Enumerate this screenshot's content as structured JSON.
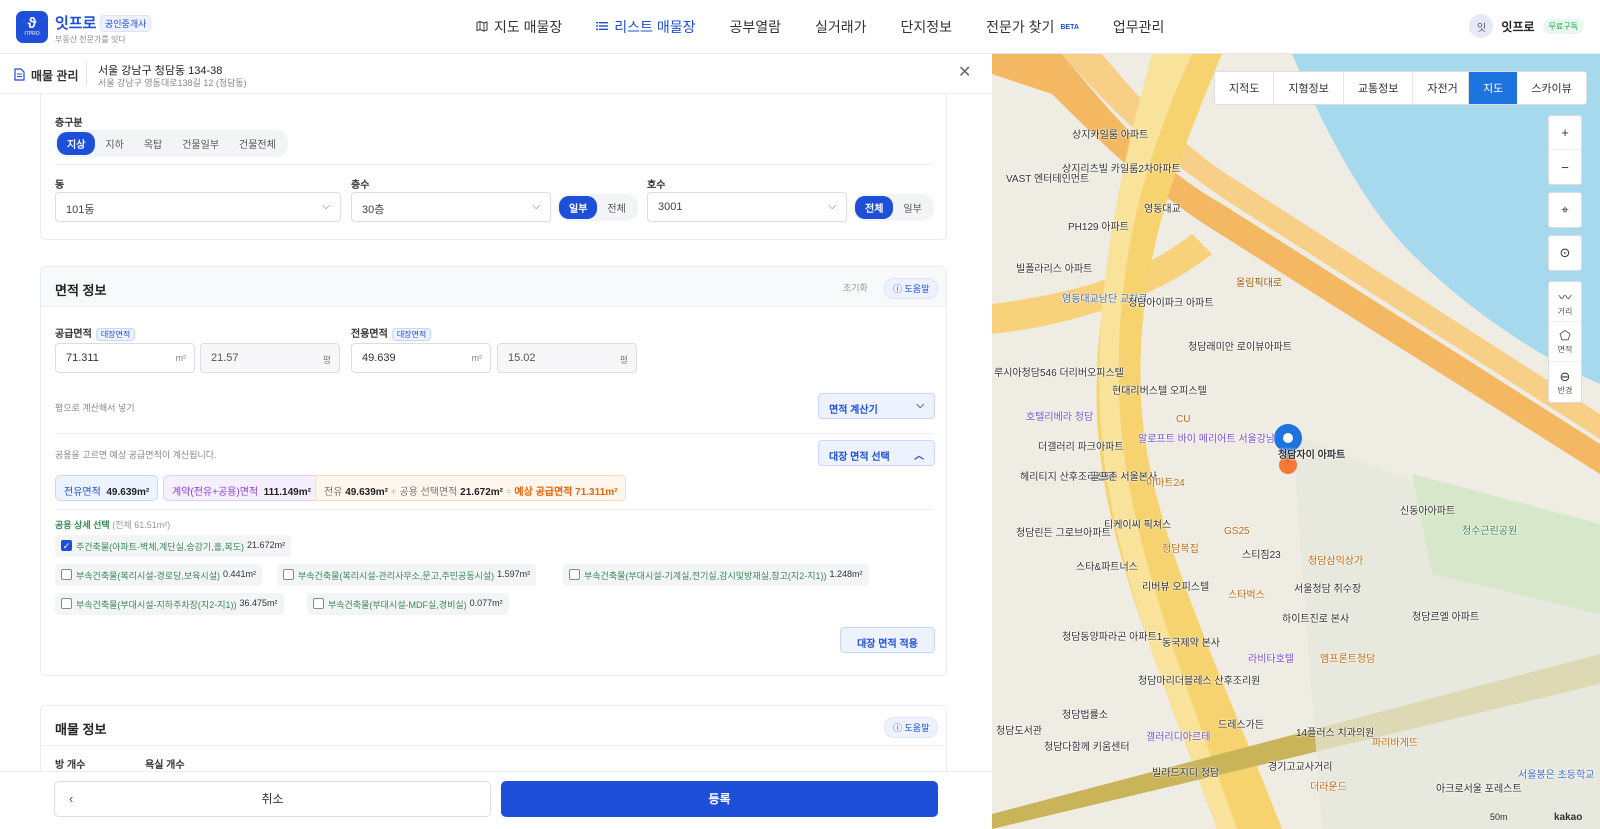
{
  "nav": {
    "logo_text": "ITPRO",
    "brand": "잇프로",
    "brand_badge": "공인중개사",
    "brand_sub": "부동산 전문가를 잇다",
    "menu": [
      {
        "label": "지도 매물장",
        "icon": "map-icon"
      },
      {
        "label": "리스트 매물장",
        "icon": "list-icon",
        "active": true
      },
      {
        "label": "공부열람",
        "icon": ""
      },
      {
        "label": "실거래가",
        "icon": ""
      },
      {
        "label": "단지정보",
        "icon": ""
      },
      {
        "label": "전문가 찾기",
        "icon": ""
      },
      {
        "label": "업무관리",
        "icon": ""
      }
    ],
    "beta": "BETA",
    "avatar": "잇",
    "user_name": "잇프로",
    "free_badge": "무료구독"
  },
  "subheader": {
    "title": "매물 관리",
    "address_main": "서울 강남구 청담동 134-38",
    "address_sub": "서울 강남구 영동대로138길 12 (청담동)"
  },
  "floor_card": {
    "floor_type_label": "층구분",
    "floor_types": [
      "지상",
      "지하",
      "옥탑",
      "건물일부",
      "건물전체"
    ],
    "floor_type_selected": "지상",
    "dong_label": "동",
    "dong_value": "101동",
    "floor_label": "층수",
    "floor_value": "30층",
    "floor_scope": [
      "일부",
      "전체"
    ],
    "floor_scope_selected": "일부",
    "ho_label": "호수",
    "ho_value": "3001",
    "ho_scope": [
      "전체",
      "일부"
    ],
    "ho_scope_selected": "전체"
  },
  "area_card": {
    "title": "면적 정보",
    "reset": "초기화",
    "help": "도움말",
    "supply_label": "공급면적",
    "supply_tag": "대장면적",
    "supply_m2": "71.311",
    "supply_pyeong": "21.57",
    "exclusive_label": "전용면적",
    "exclusive_tag": "대장면적",
    "exclusive_m2": "49.639",
    "exclusive_pyeong": "15.02",
    "unit_m2": "m²",
    "unit_pyeong": "평",
    "hint_pyeong": "평으로 계산해서 넣기",
    "calc_button": "면적 계산기",
    "hint_common": "공용을 고르면 예상 공급면적이 계산됩니다.",
    "ledger_select_button": "대장 면적 선택",
    "chip_exclusive_label": "전유면적",
    "chip_exclusive_value": "49.639m²",
    "chip_contract_label": "계약(전유+공용)면적",
    "chip_contract_value": "111.149m²",
    "calc_exclusive_label": "전유",
    "calc_exclusive_value": "49.639m²",
    "calc_plus": "+",
    "calc_common_label": "공용 선택면적",
    "calc_common_value": "21.672m²",
    "calc_eq": "=",
    "calc_expected_label": "예상 공급면적",
    "calc_expected_value": "71.311m²",
    "common_title": "공용 상세 선택",
    "common_total": "(전체 61.51m²)",
    "common_items": [
      {
        "label": "주건축물(아파트-벽체,계단실,승강기,홀,복도)",
        "value": "21.672m²",
        "checked": true
      },
      {
        "label": "부속건축물(복리시설-경로당,보육시설)",
        "value": "0.441m²",
        "checked": false
      },
      {
        "label": "부속건축물(복리시설-관리사무소,문고,주민공동시설)",
        "value": "1.597m²",
        "checked": false
      },
      {
        "label": "부속건축물(부대시설-기계실,전기실,감시및방재실,창고(지2-지1))",
        "value": "1.248m²",
        "checked": false
      },
      {
        "label": "부속건축물(부대시설-지하주차장(지2-지1))",
        "value": "36.475m²",
        "checked": false
      },
      {
        "label": "부속건축물(부대시설-MDF실,경비실)",
        "value": "0.077m²",
        "checked": false
      }
    ],
    "apply_button": "대장 면적 적용"
  },
  "property_card": {
    "title": "매물 정보",
    "help": "도움말",
    "rooms_label": "방 개수",
    "baths_label": "욕실 개수"
  },
  "footer": {
    "cancel": "취소",
    "submit": "등록"
  },
  "map": {
    "layers": [
      "지적도",
      "지형정보",
      "교통정보",
      "자전거"
    ],
    "types": [
      "지도",
      "스카이뷰"
    ],
    "type_selected": "지도",
    "zoom_in": "+",
    "zoom_out": "−",
    "tool_distance": "거리",
    "tool_area": "면적",
    "tool_radius": "반경",
    "scale": "50m",
    "provider": "kakao",
    "labels": [
      "상지카일룸 아파트",
      "상지리츠빌 카일룸2차아파트",
      "VAST 엔터테인먼트",
      "PH129 아파트",
      "빌폴라리스 아파트",
      "영동대교남단 교차로",
      "청담아이파크 아파트",
      "청담래미안 로이뷰아파트",
      "루시아청담546 더리버오피스텔",
      "현대리버스텔 오피스텔",
      "호텔리베라 청담",
      "더갤러리 파크아파트",
      "알로프트 바이 메리어트 서울강남",
      "청담자이 아파트",
      "헤리티지 산후조리센터",
      "골프존 서울본사",
      "신동아아파트",
      "청수근린공원",
      "청담린든 그로브아파트",
      "티케이씨 픽쳐스",
      "스타&파트너스",
      "청담복집",
      "스티짐23",
      "청담삼익상가",
      "리버뷰 오피스텔",
      "서울청담 취수장",
      "하이트진로 본사",
      "청담르엘 아파트",
      "청담동양파라곤 아파트1",
      "동국제약 본사",
      "라비타호텔",
      "엠프론트청담",
      "청담마리더블레스 산후조리원",
      "청담법률소",
      "드레스가든",
      "갤러리디아르테",
      "청담다함께 키움센터",
      "빌라드지디 청담",
      "청담도서관",
      "14플러스 치과의원",
      "파리바게뜨",
      "아크로서울 포레스트",
      "서울봉은 초등학교",
      "더라운드",
      "경기고교사거리",
      "GS25",
      "CU",
      "이마트24",
      "스타벅스",
      "올림픽대로",
      "영동대교"
    ]
  }
}
